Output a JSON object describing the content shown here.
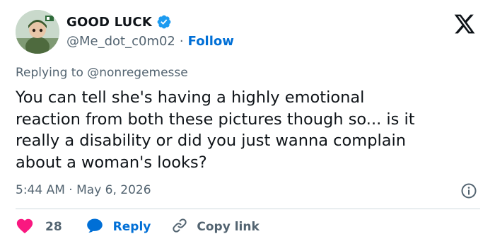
{
  "tweet": {
    "author": {
      "display_name": "GOOD LUCK",
      "handle": "@Me_dot_c0m02",
      "separator": "·",
      "follow_label": "Follow"
    },
    "replying_to_prefix": "Replying to",
    "replying_to_handle": "@nonregemesse",
    "text": "You can tell she's having a highly emotional\nreaction from both these pictures though so... is it\nreally a disability or did you just wanna complain\nabout a woman's looks?",
    "time": "5:44 AM",
    "date_separator": "·",
    "date": "May 6, 2026",
    "actions": {
      "like_count": "28",
      "reply_label": "Reply",
      "copy_link_label": "Copy link"
    }
  },
  "colors": {
    "link_blue": "#006fd6",
    "like_red": "#f91880",
    "verified_blue": "#1d9bf0",
    "muted_text": "#536471",
    "divider": "#cfd9de"
  },
  "icons": [
    "avatar",
    "verified-badge-icon",
    "x-logo-icon",
    "info-icon",
    "heart-icon",
    "reply-bubble-icon",
    "link-icon"
  ]
}
